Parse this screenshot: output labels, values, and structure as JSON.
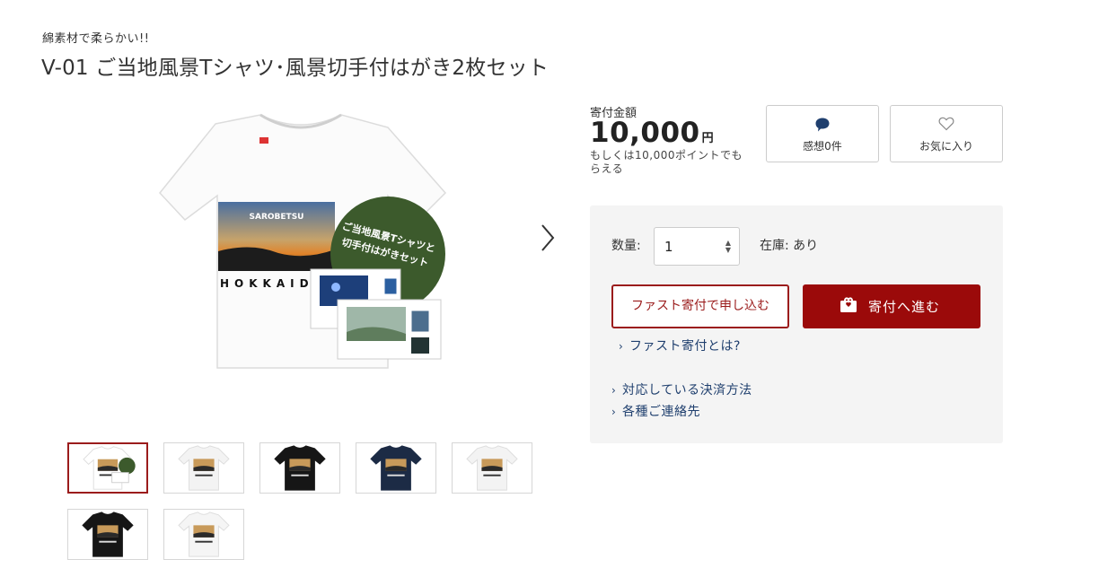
{
  "product": {
    "subtitle": "綿素材で柔らかい!!",
    "title": "V-01 ご当地風景Tシャツ･風景切手付はがき2枚セット"
  },
  "main_image": {
    "print_top": "SAROBETSU",
    "print_bottom": "HOKKAID",
    "badge_line1": "ご当地風景Tシャツと",
    "badge_line2": "切手付はがきセット"
  },
  "thumbnails": [
    {
      "alt": "Tシャツとはがきセット",
      "active": true,
      "shirt": "#ffffff"
    },
    {
      "alt": "白Tシャツ",
      "active": false,
      "shirt": "#f3f3f3"
    },
    {
      "alt": "黒Tシャツ",
      "active": false,
      "shirt": "#161616"
    },
    {
      "alt": "ネイビーTシャツ",
      "active": false,
      "shirt": "#1c2b45"
    },
    {
      "alt": "白Tシャツ2",
      "active": false,
      "shirt": "#f3f3f3"
    },
    {
      "alt": "黒Tシャツ着用",
      "active": false,
      "shirt": "#161616"
    },
    {
      "alt": "白Tシャツ3",
      "active": false,
      "shirt": "#f5f5f5"
    }
  ],
  "price": {
    "label": "寄付金額",
    "amount": "10,000",
    "unit": "円",
    "points_text": "もしくは10,000ポイントでもらえる"
  },
  "reviews_button": {
    "label": "感想0件",
    "icon": "speech-bubble-icon"
  },
  "favorite_button": {
    "label": "お気に入り",
    "icon": "heart-outline-icon"
  },
  "order": {
    "qty_label": "数量:",
    "qty_value": "1",
    "stock_label": "在庫: あり",
    "fast_button": "ファスト寄付で申し込む",
    "donate_button": "寄付へ進む",
    "fast_info_link": "ファスト寄付とは?",
    "payment_link": "対応している決済方法",
    "contact_link": "各種ご連絡先"
  },
  "colors": {
    "accent": "#9b0a0a",
    "link": "#1f3f6e",
    "panel_bg": "#f4f4f4",
    "badge_green": "#3c5a2c"
  }
}
